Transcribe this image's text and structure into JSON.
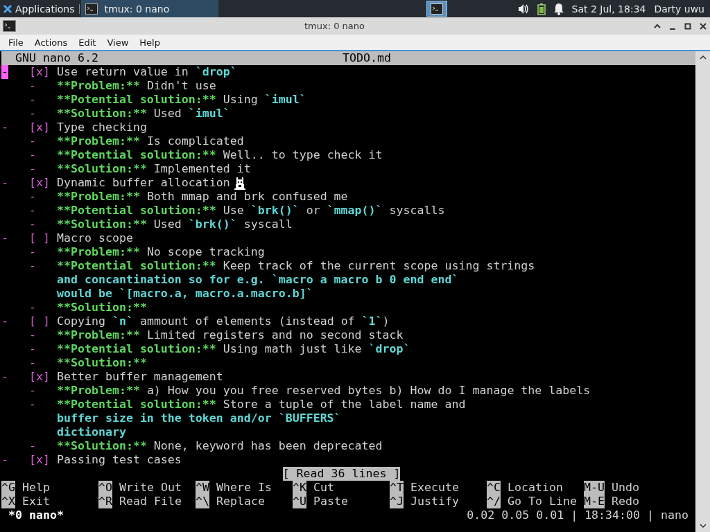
{
  "panel": {
    "apps_label": "Applications",
    "tasks": [
      {
        "label": "tmux: 0 nano",
        "selected": true
      }
    ],
    "clock": "Sat 2 Jul, 18:34",
    "user": "Darty uwu"
  },
  "window": {
    "title": "tmux: 0 nano",
    "menu": [
      "File",
      "Actions",
      "Edit",
      "View",
      "Help"
    ]
  },
  "nano": {
    "version": "GNU nano 6.2",
    "filename": "TODO.md",
    "lines": [
      {
        "kind": "task",
        "cursor": true,
        "marker": "-",
        "checkbox": "[x]",
        "checked": true,
        "parts": [
          {
            "kind": "plain",
            "text": "Use return value in "
          },
          {
            "kind": "code",
            "text": "`drop`"
          }
        ]
      },
      {
        "kind": "sub",
        "cursor": false,
        "marker": "-",
        "parts": [
          {
            "kind": "bold",
            "text": "**Problem:**"
          },
          {
            "kind": "plain",
            "text": " Didn't use"
          }
        ]
      },
      {
        "kind": "sub",
        "cursor": false,
        "marker": "-",
        "parts": [
          {
            "kind": "bold",
            "text": "**Potential solution:**"
          },
          {
            "kind": "plain",
            "text": " Using "
          },
          {
            "kind": "code",
            "text": "`imul`"
          }
        ]
      },
      {
        "kind": "sub",
        "cursor": false,
        "marker": "-",
        "parts": [
          {
            "kind": "bold",
            "text": "**Solution:**"
          },
          {
            "kind": "plain",
            "text": " Used "
          },
          {
            "kind": "code",
            "text": "`imul`"
          }
        ]
      },
      {
        "kind": "task",
        "cursor": false,
        "marker": "-",
        "checkbox": "[x]",
        "checked": true,
        "parts": [
          {
            "kind": "plain",
            "text": "Type checking"
          }
        ]
      },
      {
        "kind": "sub",
        "cursor": false,
        "marker": "-",
        "parts": [
          {
            "kind": "bold",
            "text": "**Problem:**"
          },
          {
            "kind": "plain",
            "text": " Is complicated"
          }
        ]
      },
      {
        "kind": "sub",
        "cursor": false,
        "marker": "-",
        "parts": [
          {
            "kind": "bold",
            "text": "**Potential solution:**"
          },
          {
            "kind": "plain",
            "text": " Well.. to type check it"
          }
        ]
      },
      {
        "kind": "sub",
        "cursor": false,
        "marker": "-",
        "parts": [
          {
            "kind": "bold",
            "text": "**Solution:**"
          },
          {
            "kind": "plain",
            "text": " Implemented it"
          }
        ]
      },
      {
        "kind": "task",
        "cursor": false,
        "marker": "-",
        "checkbox": "[x]",
        "checked": true,
        "parts": [
          {
            "kind": "plain",
            "text": "Dynamic buffer allocation"
          }
        ]
      },
      {
        "kind": "sub",
        "cursor": false,
        "marker": "-",
        "parts": [
          {
            "kind": "bold",
            "text": "**Problem:**"
          },
          {
            "kind": "plain",
            "text": " Both mmap and brk confused me"
          }
        ]
      },
      {
        "kind": "sub",
        "cursor": false,
        "marker": "-",
        "parts": [
          {
            "kind": "bold",
            "text": "**Potential solution:**"
          },
          {
            "kind": "plain",
            "text": " Use "
          },
          {
            "kind": "code",
            "text": "`brk()`"
          },
          {
            "kind": "plain",
            "text": " or "
          },
          {
            "kind": "code",
            "text": "`mmap()`"
          },
          {
            "kind": "plain",
            "text": " syscalls"
          }
        ]
      },
      {
        "kind": "sub",
        "cursor": false,
        "marker": "-",
        "parts": [
          {
            "kind": "bold",
            "text": "**Solution:**"
          },
          {
            "kind": "plain",
            "text": " Used "
          },
          {
            "kind": "code",
            "text": "`brk()`"
          },
          {
            "kind": "plain",
            "text": " syscall"
          }
        ]
      },
      {
        "kind": "task",
        "cursor": false,
        "marker": "-",
        "checkbox": "[ ]",
        "checked": false,
        "parts": [
          {
            "kind": "plain",
            "text": "Macro scope"
          }
        ]
      },
      {
        "kind": "sub",
        "cursor": false,
        "marker": "-",
        "parts": [
          {
            "kind": "bold",
            "text": "**Problem:**"
          },
          {
            "kind": "plain",
            "text": " No scope tracking"
          }
        ]
      },
      {
        "kind": "sub",
        "cursor": false,
        "marker": "-",
        "parts": [
          {
            "kind": "bold",
            "text": "**Potential solution:**"
          },
          {
            "kind": "plain",
            "text": " Keep track of the current scope using strings"
          }
        ]
      },
      {
        "kind": "cont",
        "cursor": false,
        "parts": [
          {
            "kind": "code",
            "text": "and concantination so for e.g. `macro a macro b 0 end end`"
          }
        ]
      },
      {
        "kind": "cont",
        "cursor": false,
        "parts": [
          {
            "kind": "code",
            "text": "would be `[macro.a, macro.a.macro.b]`"
          }
        ]
      },
      {
        "kind": "sub",
        "cursor": false,
        "marker": "-",
        "parts": [
          {
            "kind": "bold",
            "text": "**Solution:**"
          }
        ]
      },
      {
        "kind": "task",
        "cursor": false,
        "marker": "-",
        "checkbox": "[ ]",
        "checked": false,
        "parts": [
          {
            "kind": "plain",
            "text": "Copying "
          },
          {
            "kind": "code",
            "text": "`n`"
          },
          {
            "kind": "plain",
            "text": " ammount of elements (instead of "
          },
          {
            "kind": "code",
            "text": "`1`"
          },
          {
            "kind": "plain",
            "text": ")"
          }
        ]
      },
      {
        "kind": "sub",
        "cursor": false,
        "marker": "-",
        "parts": [
          {
            "kind": "bold",
            "text": "**Problem:**"
          },
          {
            "kind": "plain",
            "text": " Limited registers and no second stack"
          }
        ]
      },
      {
        "kind": "sub",
        "cursor": false,
        "marker": "-",
        "parts": [
          {
            "kind": "bold",
            "text": "**Potential solution:**"
          },
          {
            "kind": "plain",
            "text": " Using math just like "
          },
          {
            "kind": "code",
            "text": "`drop`"
          }
        ]
      },
      {
        "kind": "sub",
        "cursor": false,
        "marker": "-",
        "parts": [
          {
            "kind": "bold",
            "text": "**Solution:**"
          }
        ]
      },
      {
        "kind": "task",
        "cursor": false,
        "marker": "-",
        "checkbox": "[x]",
        "checked": true,
        "parts": [
          {
            "kind": "plain",
            "text": "Better buffer management"
          }
        ]
      },
      {
        "kind": "sub",
        "cursor": false,
        "marker": "-",
        "parts": [
          {
            "kind": "bold",
            "text": "**Problem:**"
          },
          {
            "kind": "plain",
            "text": " a) How you you free reserved bytes b) How do I manage the labels"
          }
        ]
      },
      {
        "kind": "sub",
        "cursor": false,
        "marker": "-",
        "parts": [
          {
            "kind": "bold",
            "text": "**Potential solution:**"
          },
          {
            "kind": "plain",
            "text": " Store a tuple of the label name and"
          }
        ]
      },
      {
        "kind": "cont",
        "cursor": false,
        "parts": [
          {
            "kind": "code",
            "text": "buffer size in the token and/or `BUFFERS`"
          }
        ]
      },
      {
        "kind": "cont",
        "cursor": false,
        "parts": [
          {
            "kind": "code",
            "text": "dictionary"
          }
        ]
      },
      {
        "kind": "sub",
        "cursor": false,
        "marker": "-",
        "parts": [
          {
            "kind": "bold",
            "text": "**Solution:**"
          },
          {
            "kind": "plain",
            "text": " None, keyword has been deprecated"
          }
        ]
      },
      {
        "kind": "task",
        "cursor": false,
        "marker": "-",
        "checkbox": "[x]",
        "checked": true,
        "parts": [
          {
            "kind": "plain",
            "text": "Passing test cases"
          }
        ]
      }
    ],
    "message": "[ Read 36 lines ]",
    "shortcut_rows": [
      [
        {
          "key": "^G",
          "label": "Help"
        },
        {
          "key": "^O",
          "label": "Write Out"
        },
        {
          "key": "^W",
          "label": "Where Is"
        },
        {
          "key": "^K",
          "label": "Cut"
        },
        {
          "key": "^T",
          "label": "Execute"
        },
        {
          "key": "^C",
          "label": "Location"
        },
        {
          "key": "M-U",
          "label": "Undo"
        }
      ],
      [
        {
          "key": "^X",
          "label": "Exit"
        },
        {
          "key": "^R",
          "label": "Read File"
        },
        {
          "key": "^\\",
          "label": "Replace"
        },
        {
          "key": "^U",
          "label": "Paste"
        },
        {
          "key": "^J",
          "label": "Justify"
        },
        {
          "key": "^/",
          "label": "Go To Line"
        },
        {
          "key": "M-E",
          "label": "Redo"
        }
      ]
    ]
  },
  "tmux_status": {
    "window": "*0 nano*",
    "right": "0.02 0.05 0.01 | 18:34:00 | nano"
  }
}
